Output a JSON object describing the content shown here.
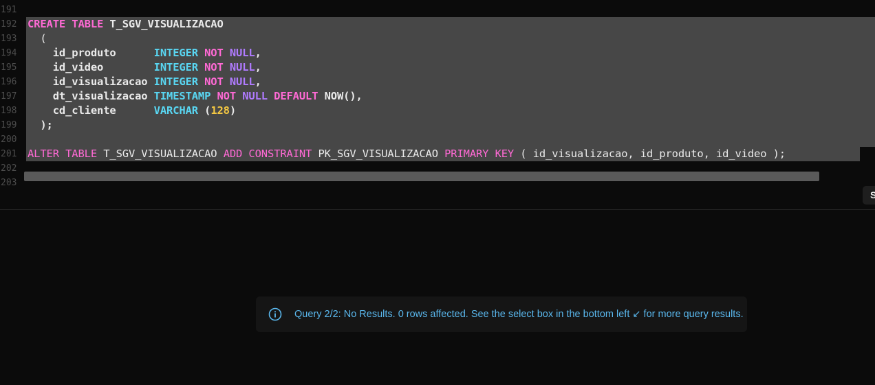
{
  "editor": {
    "line_numbers": [
      "191",
      "192",
      "193",
      "194",
      "195",
      "196",
      "197",
      "198",
      "199",
      "200",
      "201",
      "202",
      "203"
    ],
    "create": {
      "kw_create": "CREATE",
      "kw_table": "TABLE",
      "table_name": "T_SGV_VISUALIZACAO",
      "open_paren": "(",
      "columns": [
        {
          "name": "id_produto      ",
          "type": "INTEGER",
          "not": "NOT",
          "null": "NULL",
          "tail": ","
        },
        {
          "name": "id_video        ",
          "type": "INTEGER",
          "not": "NOT",
          "null": "NULL",
          "tail": ","
        },
        {
          "name": "id_visualizacao ",
          "type": "INTEGER",
          "not": "NOT",
          "null": "NULL",
          "tail": ","
        },
        {
          "name": "dt_visualizacao ",
          "type": "TIMESTAMP",
          "not": "NOT",
          "null": "NULL",
          "default": "DEFAULT",
          "func": "NOW",
          "func_tail": "(),"
        },
        {
          "name": "cd_cliente      ",
          "type": "VARCHAR",
          "open": "(",
          "size": "128",
          "close": ")"
        }
      ],
      "close": ");"
    },
    "alter": {
      "kw_alter": "ALTER",
      "kw_table": "TABLE",
      "table_name": "T_SGV_VISUALIZACAO",
      "kw_add": "ADD",
      "kw_constraint": "CONSTRAINT",
      "constraint_name": "PK_SGV_VISUALIZACAO",
      "kw_primary": "PRIMARY",
      "kw_key": "KEY",
      "args": "( id_visualizacao, id_produto, id_video );"
    }
  },
  "side_button": {
    "label": "S"
  },
  "toast": {
    "icon": "info-icon",
    "message": "Query 2/2: No Results. 0 rows affected. See the select box in the bottom left ↙ for more query results."
  },
  "colors": {
    "keyword_pink": "#ff6ad5",
    "keyword_cyan": "#59d6f2",
    "keyword_purple": "#b07bff",
    "number": "#f5c842",
    "selection": "#474747",
    "toast_text": "#5ab8ee"
  }
}
